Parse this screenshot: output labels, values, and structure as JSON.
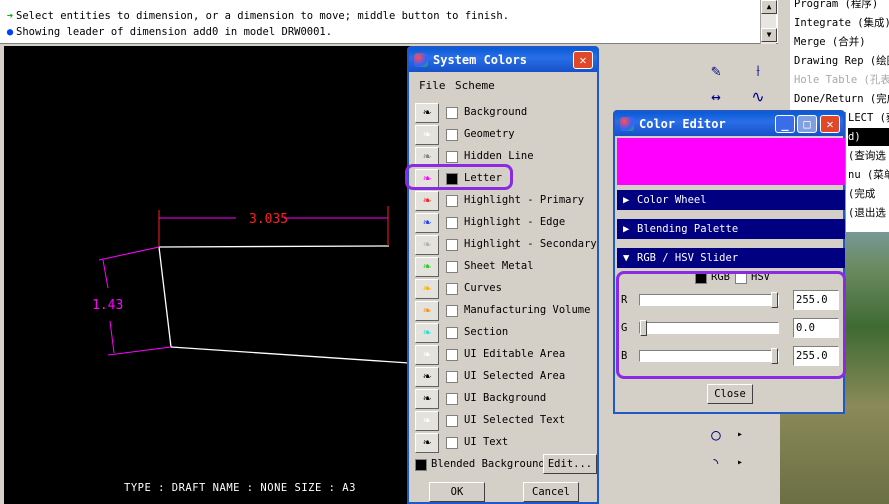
{
  "message_area": {
    "line1": "Select entities to dimension, or a dimension to move; middle button to finish.",
    "line2": "Showing leader of dimension add0 in model DRW0001."
  },
  "right_menu": {
    "items": [
      {
        "label": "Program (程序)",
        "disabled": false
      },
      {
        "label": "Integrate (集成)",
        "disabled": false
      },
      {
        "label": "Merge (合并)",
        "disabled": false
      },
      {
        "label": "Drawing Rep (绘图",
        "disabled": false
      },
      {
        "label": "Hole Table (孔表",
        "disabled": true
      },
      {
        "label": "Done/Return (完成",
        "disabled": false
      }
    ]
  },
  "side_menu": {
    "items": [
      "LECT (获",
      "d)",
      "(查询选",
      "nu (菜单",
      "(完成",
      "(退出选"
    ]
  },
  "drawing": {
    "dim_horizontal": "3.035",
    "dim_vertical": "1.43",
    "status": "TYPE : DRAFT   NAME : NONE   SIZE : A3",
    "dim_color": "#ff00ff",
    "line_color": "#ffffff",
    "leader_color": "#ff2020"
  },
  "system_colors": {
    "title": "System Colors",
    "menu": [
      "File",
      "Scheme"
    ],
    "rows": [
      {
        "label": "Background",
        "color": "#000000",
        "checked": false
      },
      {
        "label": "Geometry",
        "color": "#ffffff",
        "checked": false
      },
      {
        "label": "Hidden Line",
        "color": "#808080",
        "checked": false
      },
      {
        "label": "Letter",
        "color": "#ff00ff",
        "checked": true
      },
      {
        "label": "Highlight - Primary",
        "color": "#ff2020",
        "checked": false
      },
      {
        "label": "Highlight - Edge",
        "color": "#2040ff",
        "checked": false
      },
      {
        "label": "Highlight - Secondary",
        "color": "#b0b0b0",
        "checked": false
      },
      {
        "label": "Sheet Metal",
        "color": "#20d020",
        "checked": false
      },
      {
        "label": "Curves",
        "color": "#ffb000",
        "checked": false
      },
      {
        "label": "Manufacturing Volume",
        "color": "#ff9020",
        "checked": false
      },
      {
        "label": "Section",
        "color": "#20e0e0",
        "checked": false
      },
      {
        "label": "UI Editable Area",
        "color": "#ffffff",
        "checked": false
      },
      {
        "label": "UI Selected Area",
        "color": "#000000",
        "checked": false
      },
      {
        "label": "UI Background",
        "color": "#000000",
        "checked": false
      },
      {
        "label": "UI Selected Text",
        "color": "#ffffff",
        "checked": false
      },
      {
        "label": "UI Text",
        "color": "#000000",
        "checked": false
      }
    ],
    "blended_label": "Blended Background",
    "blended_checked": true,
    "edit_label": "Edit...",
    "ok_label": "OK",
    "cancel_label": "Cancel"
  },
  "color_editor": {
    "title": "Color Editor",
    "preview_color": "#ff00ff",
    "sections": [
      "Color Wheel",
      "Blending Palette",
      "RGB / HSV Slider"
    ],
    "mode_rgb": "RGB",
    "mode_hsv": "HSV",
    "rgb_checked": true,
    "hsv_checked": false,
    "sliders": [
      {
        "label": "R",
        "value": "255.0",
        "fraction": 1.0
      },
      {
        "label": "G",
        "value": "0.0",
        "fraction": 0.0
      },
      {
        "label": "B",
        "value": "255.0",
        "fraction": 1.0
      }
    ],
    "close_label": "Close"
  }
}
